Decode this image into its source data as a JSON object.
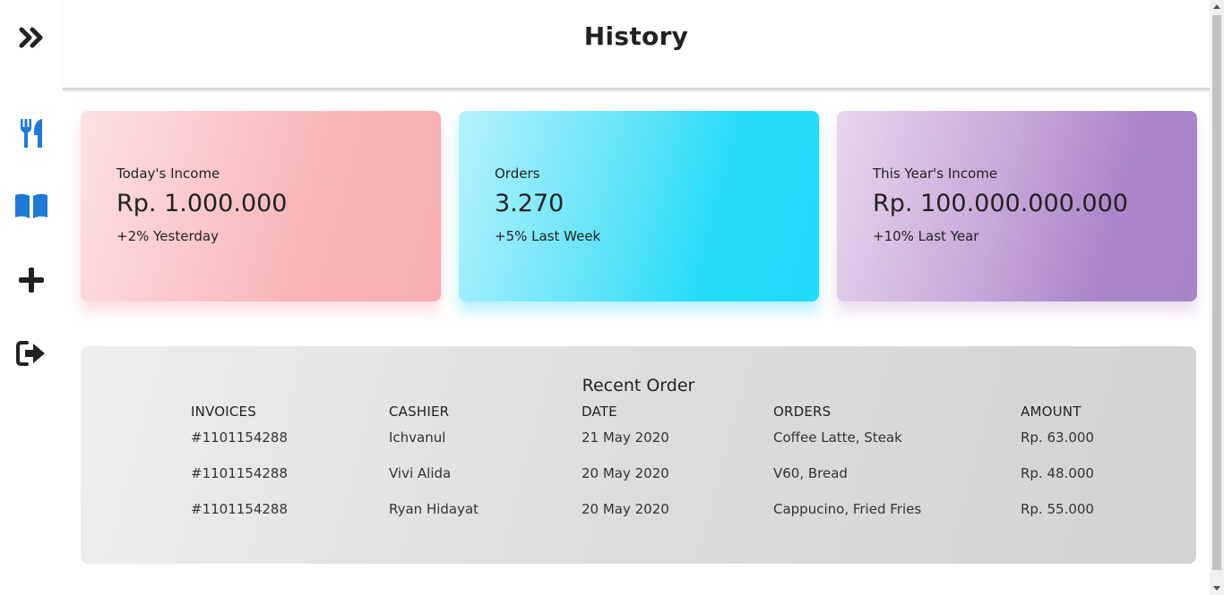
{
  "sidebar": {
    "items": [
      {
        "icon": "chevrons-right-icon"
      },
      {
        "icon": "utensils-icon",
        "color": "#1e7ad6"
      },
      {
        "icon": "book-open-icon",
        "color": "#1e7ad6"
      },
      {
        "icon": "plus-icon"
      },
      {
        "icon": "sign-out-icon"
      }
    ]
  },
  "header": {
    "title": "History"
  },
  "cards": [
    {
      "label": "Today's Income",
      "value": "Rp. 1.000.000",
      "sub": "+2% Yesterday",
      "color": "#f8b4b8"
    },
    {
      "label": "Orders",
      "value": "3.270",
      "sub": "+5% Last Week",
      "color": "#25dcf9"
    },
    {
      "label": "This Year's Income",
      "value": "Rp. 100.000.000.000",
      "sub": "+10% Last Year",
      "color": "#ab85c8"
    }
  ],
  "recent_orders": {
    "title": "Recent Order",
    "columns": [
      "INVOICES",
      "CASHIER",
      "DATE",
      "ORDERS",
      "AMOUNT"
    ],
    "rows": [
      [
        "#1101154288",
        "Ichvanul",
        "21 May 2020",
        "Coffee Latte, Steak",
        "Rp. 63.000"
      ],
      [
        "#1101154288",
        "Vivi Alida",
        "20 May 2020",
        "V60, Bread",
        "Rp. 48.000"
      ],
      [
        "#1101154288",
        "Ryan Hidayat",
        "20 May 2020",
        "Cappucino, Fried Fries",
        "Rp. 55.000"
      ]
    ]
  }
}
